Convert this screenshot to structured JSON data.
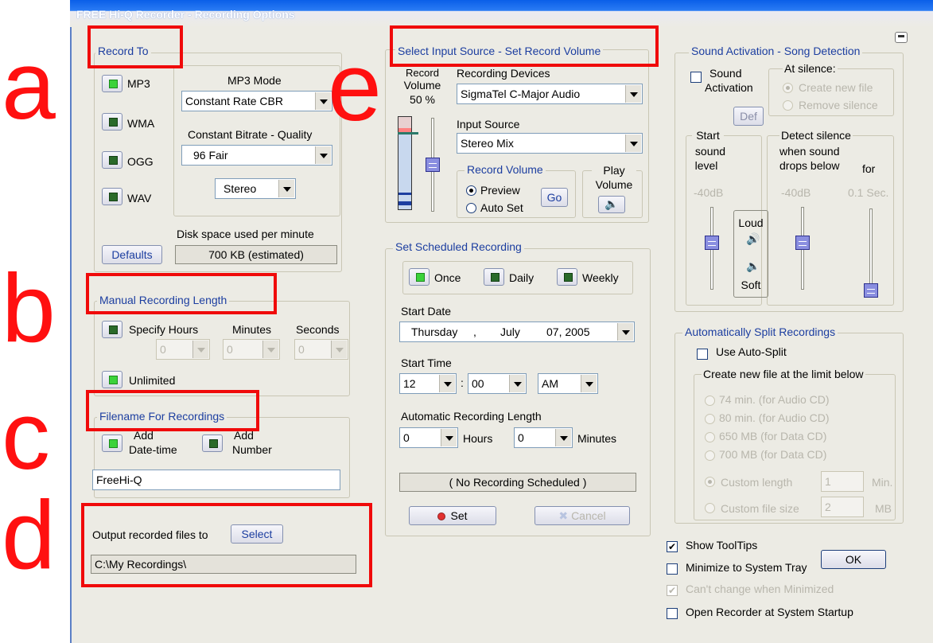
{
  "annotations": {
    "a": "a",
    "b": "b",
    "c": "c",
    "d": "d",
    "e": "e"
  },
  "window": {
    "title": "FREE Hi-Q Recorder - Recording Options"
  },
  "record_to": {
    "group_title": "Record To",
    "formats": [
      "MP3",
      "WMA",
      "OGG",
      "WAV"
    ],
    "selected_format": "MP3",
    "mp3_mode_label": "MP3 Mode",
    "mp3_mode_value": "Constant Rate CBR",
    "bitrate_label": "Constant Bitrate - Quality",
    "bitrate_value": "96  Fair",
    "channels_value": "Stereo",
    "defaults_button": "Defaults",
    "disk_label": "Disk space used per minute",
    "disk_value": "700  KB (estimated)"
  },
  "manual_length": {
    "group_title": "Manual Recording Length",
    "specify_hours": "Specify Hours",
    "minutes": "Minutes",
    "seconds": "Seconds",
    "hours_value": "0",
    "minutes_value": "0",
    "seconds_value": "0",
    "unlimited": "Unlimited",
    "unlimited_selected": true
  },
  "filename": {
    "group_title": "Filename For Recordings",
    "add_datetime_line1": "Add",
    "add_datetime_line2": "Date-time",
    "add_number_line1": "Add",
    "add_number_line2": "Number",
    "name_value": "FreeHi-Q"
  },
  "output": {
    "label": "Output recorded files to",
    "select_button": "Select",
    "path": "C:\\My Recordings\\"
  },
  "input_source": {
    "group_title": "Select Input Source - Set Record Volume",
    "record_volume_line1": "Record",
    "record_volume_line2": "Volume",
    "record_volume_value": "50 %",
    "record_volume_level": 0.5,
    "devices_label": "Recording Devices",
    "device_value": "SigmaTel C-Major Audio",
    "input_source_label": "Input Source",
    "input_source_value": "Stereo Mix",
    "record_volume_group": "Record Volume",
    "preview": "Preview",
    "auto_set": "Auto Set",
    "go_button": "Go",
    "play_volume_line1": "Play",
    "play_volume_line2": "Volume"
  },
  "scheduled": {
    "group_title": "Set Scheduled Recording",
    "once": "Once",
    "daily": "Daily",
    "weekly": "Weekly",
    "start_date_label": "Start Date",
    "start_date_day": "Thursday",
    "start_date_comma": ",",
    "start_date_month": "July",
    "start_date_date": "07, 2005",
    "start_time_label": "Start Time",
    "hour_value": "12",
    "colon": ":",
    "minute_value": "00",
    "ampm_value": "AM",
    "auto_length_label": "Automatic Recording Length",
    "hours_value": "0",
    "hours_label": "Hours",
    "minutes_value": "0",
    "minutes_label": "Minutes",
    "status": "( No Recording Scheduled )",
    "set_button": "Set",
    "cancel_button": "Cancel"
  },
  "sound_activation": {
    "group_title": "Sound Activation - Song Detection",
    "sound_activation_line1": "Sound",
    "sound_activation_line2": "Activation",
    "at_silence": "At silence:",
    "create_new_file": "Create new file",
    "remove_silence": "Remove silence",
    "def_button": "Def",
    "start_line1": "Start",
    "start_line2": "sound",
    "start_line3": "level",
    "detect_line1": "Detect silence",
    "detect_line2": "when sound",
    "detect_line3": "drops below",
    "for_label": "for",
    "start_db": "-40dB",
    "detect_db": "-40dB",
    "sec_value": "0.1  Sec.",
    "loud": "Loud",
    "soft": "Soft"
  },
  "auto_split": {
    "group_title": "Automatically Split Recordings",
    "use_auto_split": "Use Auto-Split",
    "create_limit": "Create new file at the limit below",
    "options": [
      "74 min. (for Audio CD)",
      "80 min. (for Audio CD)",
      "650 MB (for Data CD)",
      "700 MB (for Data CD)"
    ],
    "custom_length": "Custom length",
    "custom_length_value": "1",
    "custom_length_unit": "Min.",
    "custom_size": "Custom file size",
    "custom_size_value": "2",
    "custom_size_unit": "MB"
  },
  "options": {
    "show_tooltips": "Show ToolTips",
    "minimize_tray": "Minimize to System Tray",
    "cant_change": "Can't change when Minimized",
    "open_startup": "Open Recorder at System Startup",
    "ok_button": "OK"
  }
}
